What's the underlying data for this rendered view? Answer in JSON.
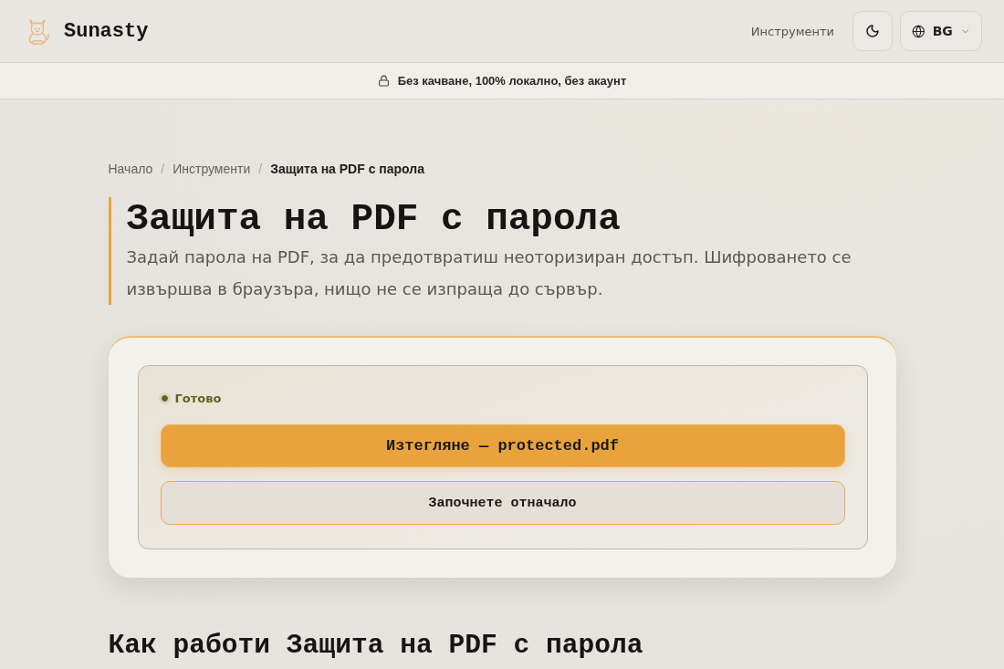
{
  "header": {
    "brand": "Sunasty",
    "nav_link": "Инструменти",
    "language": "BG"
  },
  "banner": {
    "text": "Без качване, 100% локално, без акаунт"
  },
  "breadcrumb": {
    "items": [
      {
        "label": "Начало",
        "current": false
      },
      {
        "label": "Инструменти",
        "current": false
      },
      {
        "label": "Защита на PDF с парола",
        "current": true
      }
    ],
    "separators": [
      "/",
      "/"
    ]
  },
  "page": {
    "title": "Защита на PDF с парола",
    "description": "Задай парола на PDF, за да предотвратиш неоторизиран достъп. Шифроването се извършва в браузъра, нищо не се изпраща до сървър."
  },
  "result_panel": {
    "status": {
      "label": "Готово",
      "color": "#5a6b1e"
    },
    "buttons": [
      {
        "label": "Изтегляне — protected.pdf",
        "kind": "primary"
      },
      {
        "label": "Започнете отначало",
        "kind": "secondary"
      }
    ]
  },
  "section_heading": "Как работи Защита на PDF с парола"
}
